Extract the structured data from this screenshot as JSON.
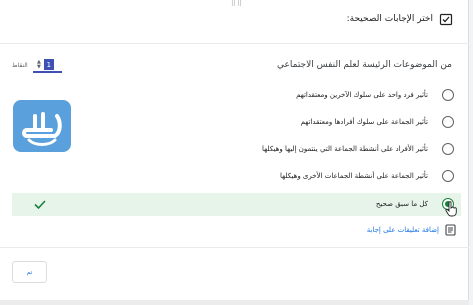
{
  "header": {
    "title": "اختر الإجابات الصحيحة:",
    "icon": "checklist-icon"
  },
  "question": {
    "text": "من الموضوعات الرئيسة لعلم النفس الاجتماعي",
    "points_label": "النقاط",
    "points_value": "1"
  },
  "options": [
    {
      "label": "تأثير فرد واحد على سلوك الآخرين ومعتقداتهم"
    },
    {
      "label": "تأثير الجماعة على سلوك أفرادها ومعتقداتهم"
    },
    {
      "label": "تأثير الأفراد على أنشطة الجماعة التي ينتمون إليها وهيكلها"
    },
    {
      "label": "تأثير الجماعة على أنشطة الجماعات الأخرى وهيكلها"
    },
    {
      "label": "كل ما سبق صحيح"
    }
  ],
  "selected_option_index": 4,
  "feedback": {
    "text": "إضافة تعليقات على إجابة",
    "icon": "feedback-icon"
  },
  "done_button": {
    "label": "تم"
  },
  "colors": {
    "accent": "#3f51b5",
    "correct_bg": "#e6f4ea",
    "correct": "#188038",
    "link": "#1a73e8"
  }
}
